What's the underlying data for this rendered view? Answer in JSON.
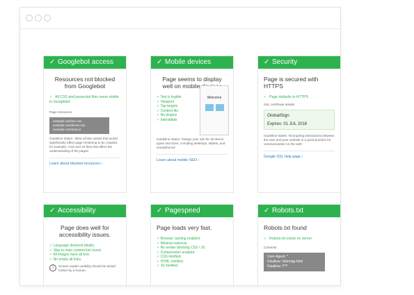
{
  "cards": {
    "googlebot": {
      "header": "Googlebot access",
      "title": "Resources not blocked from Googlebot",
      "check": "All CSS and javascript files seem visible to Googlebot",
      "resources_label": "Page resources",
      "resources": [
        "example.com/min.css",
        "example.com/theme.css",
        "example.com/main.js"
      ],
      "guideline": "Guideline states: 'allow all site assets that would significantly affect page rendering to be crawled, for example, CSS and JS files that affect the understanding of the pages'",
      "link": "Learn about blocked resources ›"
    },
    "mobile": {
      "header": "Mobile devices",
      "title": "Page seems to display well on mobile devices",
      "checks": [
        "Text is legible",
        "Viewport",
        "Tap targets",
        "Content fits",
        "No plugins",
        "Interstitials"
      ],
      "phone_text": "Welcome",
      "guideline": "Guideline states: 'Design your site for all device types and sizes, including desktops, tablets, and smartphones'",
      "link": "Learn about mobile SEO ›"
    },
    "security": {
      "header": "Security",
      "title": "Page is secured with HTTPS",
      "check": "Page defaults to HTTPS",
      "ssl_label": "SSL certificate details",
      "cert_name": "GlobalSign",
      "cert_expires": "Expires: 01 JUL 2018",
      "guideline": "Guideline states: 'Encrypting interactions between the user and your website is a good practice for communication on the web'",
      "link": "Google SSL help page ›"
    },
    "accessibility": {
      "header": "Accessibility",
      "title": "Page does well for accessibility issues.",
      "checks": [
        "Language declared ideally.",
        "Skip to main content link found.",
        "All images have alt text.",
        "No empty alt links."
      ],
      "note": "Screen reader usability should be tested further by a human."
    },
    "pagespeed": {
      "header": "Pagespeed",
      "title": "Page loads very fast.",
      "checks": [
        "Browser caching enabled.",
        "Minimal redirects.",
        "No render blocking CSS / JS.",
        "Compression enabled.",
        "CSS minified.",
        "HTML minified.",
        "JS minified."
      ]
    },
    "robots": {
      "header": "Robots.txt",
      "title": "Robots.txt found",
      "check": "Robots.txt exists on server",
      "contents_label": "Contents",
      "contents": [
        "User-Agent: *",
        "Disallow: /sitemap.html",
        "Disallow: /*?*"
      ]
    }
  },
  "colors": {
    "accent": "#2db24f",
    "link": "#1a7cc0"
  }
}
